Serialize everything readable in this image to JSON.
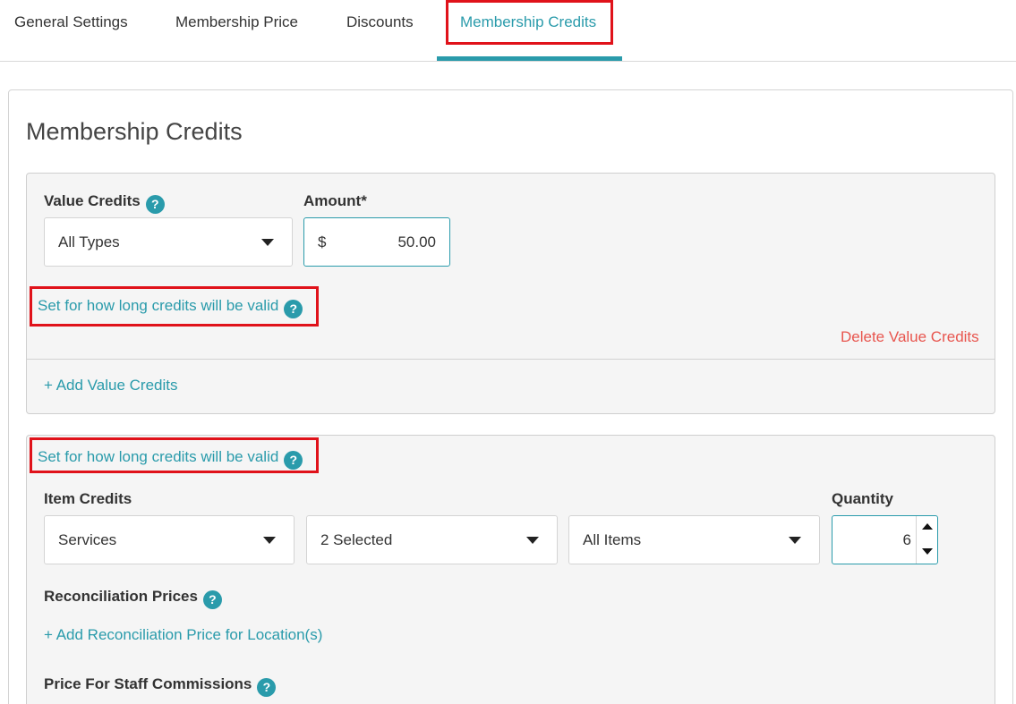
{
  "tabs": [
    {
      "label": "General Settings"
    },
    {
      "label": "Membership Price"
    },
    {
      "label": "Discounts"
    },
    {
      "label": "Membership Credits",
      "active": true
    }
  ],
  "section": {
    "title": "Membership Credits"
  },
  "value_credits": {
    "label": "Value Credits",
    "type_select": {
      "value": "All Types"
    },
    "amount": {
      "label": "Amount*",
      "currency": "$",
      "value": "50.00"
    },
    "valid_link": "Set for how long credits will be valid",
    "delete_link": "Delete Value Credits",
    "add_link": "+ Add Value Credits"
  },
  "item_credits": {
    "valid_link": "Set for how long credits will be valid",
    "label": "Item Credits",
    "category_select": {
      "value": "Services"
    },
    "selection_select": {
      "value": "2 Selected"
    },
    "items_select": {
      "value": "All Items"
    },
    "quantity": {
      "label": "Quantity",
      "value": "6"
    },
    "reconciliation": {
      "label": "Reconciliation Prices",
      "add_link": "+ Add Reconciliation Price for Location(s)"
    },
    "staff_commissions": {
      "label": "Price For Staff Commissions"
    }
  },
  "help_glyph": "?",
  "colors": {
    "accent": "#2a9bab",
    "danger": "#e8554e",
    "highlight": "#e0121a"
  }
}
